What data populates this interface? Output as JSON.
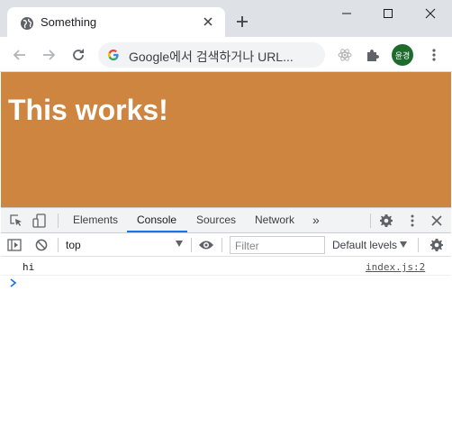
{
  "browser": {
    "tab": {
      "title": "Something",
      "favicon": "globe-icon"
    },
    "omnibox": {
      "text": "Google에서 검색하거나 URL..."
    },
    "avatar": {
      "label": "윤경",
      "color": "#1e6b2e"
    },
    "colors": {
      "titlebar": "#dee1e6",
      "toolbar": "#ffffff",
      "accent": "#1a73e8"
    }
  },
  "page": {
    "heading": "This works!",
    "background": "#cd853f",
    "text_color": "#ffffff"
  },
  "devtools": {
    "tabs": [
      {
        "label": "Elements",
        "active": false
      },
      {
        "label": "Console",
        "active": true
      },
      {
        "label": "Sources",
        "active": false
      },
      {
        "label": "Network",
        "active": false
      }
    ],
    "more_tabs": "»",
    "console": {
      "context": "top",
      "filter_placeholder": "Filter",
      "levels": "Default levels",
      "messages": [
        {
          "text": "hi",
          "source": "index.js:2"
        }
      ],
      "prompt": "›"
    }
  }
}
